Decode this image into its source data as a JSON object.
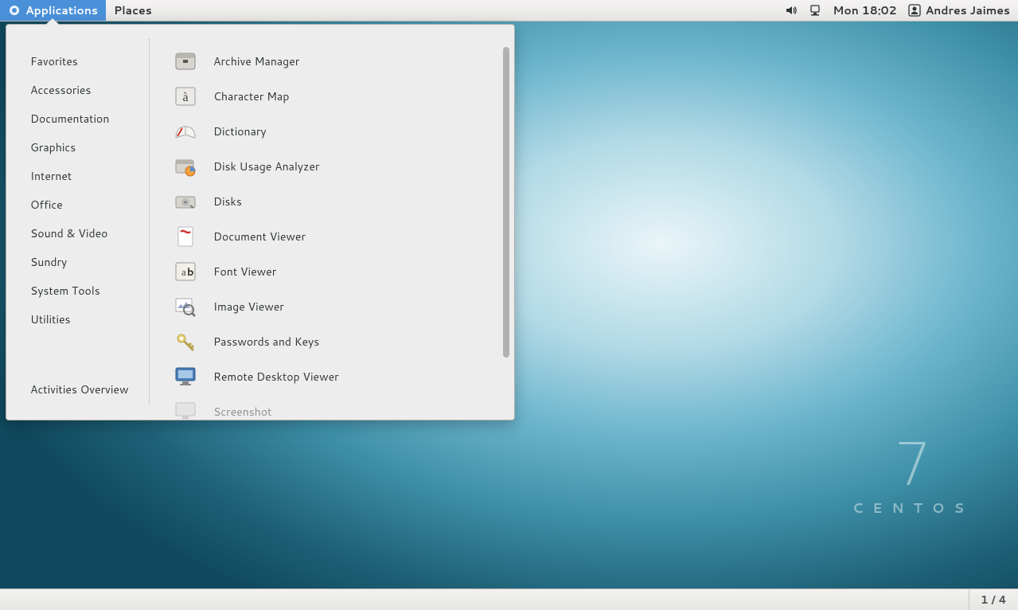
{
  "panel": {
    "applications_label": "Applications",
    "places_label": "Places",
    "clock": "Mon 18:02",
    "username": "Andres Jaimes"
  },
  "menu": {
    "categories": [
      "Favorites",
      "Accessories",
      "Documentation",
      "Graphics",
      "Internet",
      "Office",
      "Sound & Video",
      "Sundry",
      "System Tools",
      "Utilities"
    ],
    "activities_overview": "Activities Overview",
    "apps": [
      "Archive Manager",
      "Character Map",
      "Dictionary",
      "Disk Usage Analyzer",
      "Disks",
      "Document Viewer",
      "Font Viewer",
      "Image Viewer",
      "Passwords and Keys",
      "Remote Desktop Viewer",
      "Screenshot"
    ]
  },
  "brand": {
    "version": "7",
    "name": "CENTOS"
  },
  "bottom": {
    "workspace": "1 / 4"
  }
}
